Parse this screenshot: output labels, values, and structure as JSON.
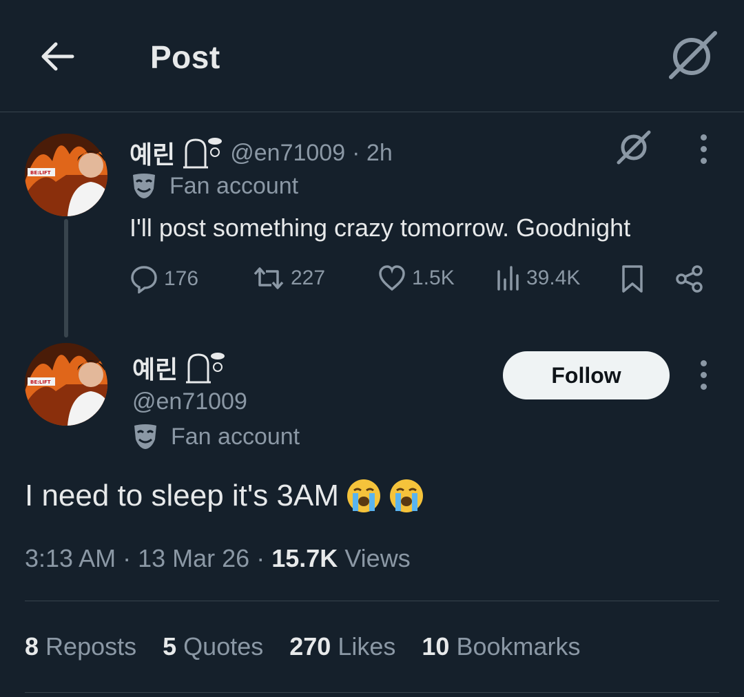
{
  "header": {
    "title": "Post",
    "back_icon": "arrow-left-icon",
    "grok_icon": "grok-icon"
  },
  "colors": {
    "background": "#15202b",
    "text": "#e7e9ea",
    "muted": "#8b98a5",
    "divider": "#38444d",
    "follow_bg": "#eff3f4"
  },
  "parent_post": {
    "display_name": "예린",
    "handle": "@en71009",
    "time": "· 2h",
    "label": "Fan account",
    "text": "I'll post something crazy tomorrow. Goodnight",
    "actions": {
      "replies": "176",
      "reposts": "227",
      "likes": "1.5K",
      "views": "39.4K"
    }
  },
  "main_post": {
    "display_name": "예린",
    "handle": "@en71009",
    "label": "Fan account",
    "follow_label": "Follow",
    "text": "I need to sleep it's 3AM",
    "emoji": "loudly-crying-face",
    "time": "3:13 AM",
    "date": "13 Mar 26",
    "views_count": "15.7K",
    "views_label": "Views"
  },
  "stats": {
    "reposts": {
      "count": "8",
      "label": "Reposts"
    },
    "quotes": {
      "count": "5",
      "label": "Quotes"
    },
    "likes": {
      "count": "270",
      "label": "Likes"
    },
    "bookmarks": {
      "count": "10",
      "label": "Bookmarks"
    }
  },
  "avatar_badge": "BE:LIFT"
}
